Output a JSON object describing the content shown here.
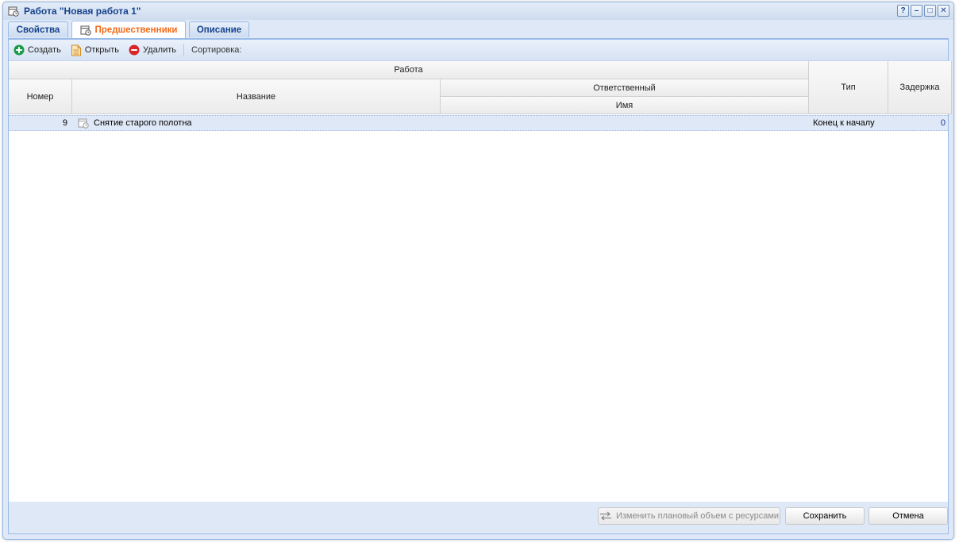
{
  "window": {
    "title": "Работа \"Новая работа 1\"",
    "tools": [
      "?",
      "–",
      "□",
      "✕"
    ]
  },
  "tabs": [
    {
      "label": "Свойства"
    },
    {
      "label": "Предшественники"
    },
    {
      "label": "Описание"
    }
  ],
  "toolbar": {
    "create_label": "Создать",
    "open_label": "Открыть",
    "delete_label": "Удалить",
    "sort_label": "Сортировка:"
  },
  "grid": {
    "header": {
      "group_work": "Работа",
      "number": "Номер",
      "name": "Название",
      "responsible": "Ответственный",
      "responsible_name": "Имя",
      "type": "Тип",
      "delay": "Задержка"
    },
    "rows": [
      {
        "number": "9",
        "name": "Снятие старого полотна",
        "responsible": "",
        "type": "Конец к началу",
        "delay": "0"
      }
    ]
  },
  "footer": {
    "change_label": "Изменить плановый объем с ресурсами",
    "save_label": "Сохранить",
    "cancel_label": "Отмена"
  },
  "colors": {
    "accent": "#15428b",
    "active_tab": "#f06a1a",
    "delay_value": "#1c3c99"
  }
}
